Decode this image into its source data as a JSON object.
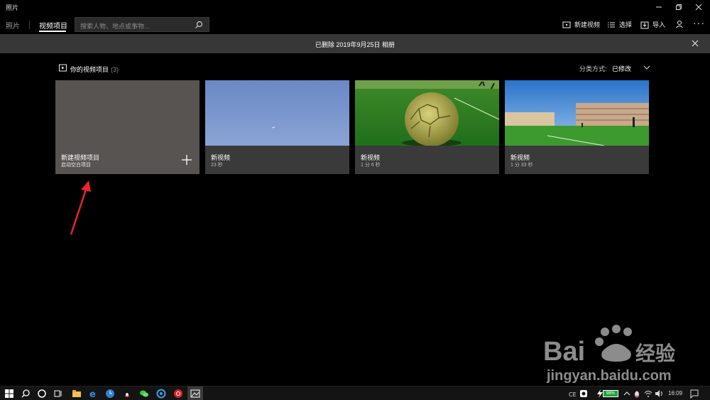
{
  "window": {
    "title": "照片"
  },
  "nav": {
    "tabs": [
      {
        "label": "照片"
      },
      {
        "label": "视频项目"
      }
    ],
    "search_placeholder": "搜索人物、地点或事物...",
    "commands": {
      "new_video": "新建视频",
      "select": "选择",
      "import": "导入",
      "more": "···"
    }
  },
  "banner": {
    "text": "已删除 2019年9月25日 相册"
  },
  "section": {
    "title": "你的视频项目",
    "count": "(3)",
    "sort_label": "分类方式:",
    "sort_value": "已修改"
  },
  "cards": [
    {
      "title": "新建视频项目",
      "subtitle": "启动空白项目"
    },
    {
      "title": "新视频",
      "subtitle": "23 秒"
    },
    {
      "title": "新视频",
      "subtitle": "1 分 6 秒"
    },
    {
      "title": "新视频",
      "subtitle": "1 分 33 秒"
    }
  ],
  "watermark": {
    "text": "jingyan.baidu.com"
  },
  "taskbar": {
    "clock": "16:09",
    "battery": "98%"
  },
  "colors": {
    "annotation_arrow": "#e8262b",
    "battery_green": "#1fa33b",
    "banner_bg": "#373737"
  }
}
